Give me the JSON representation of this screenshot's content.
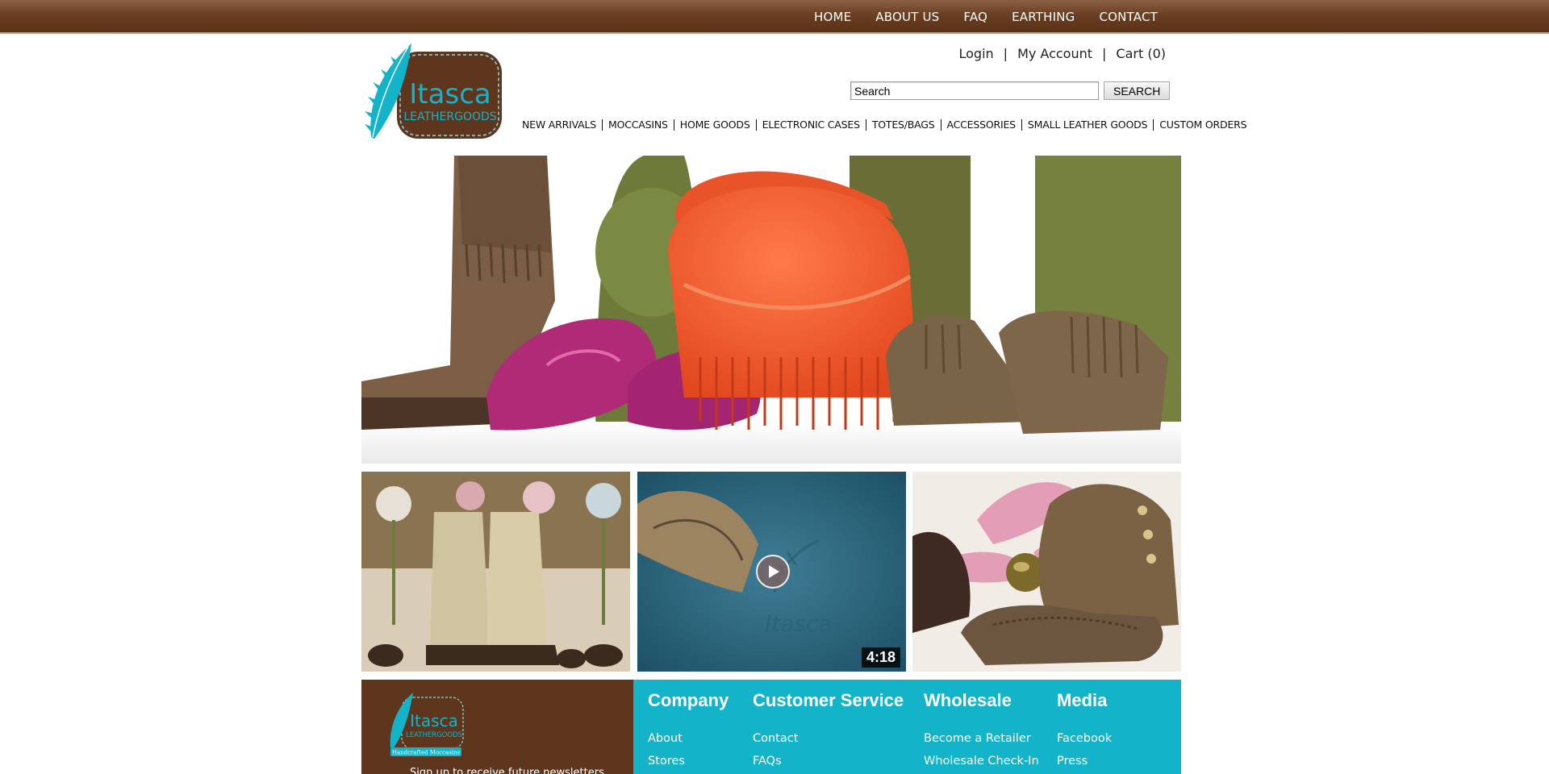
{
  "topnav": [
    {
      "label": "HOME"
    },
    {
      "label": "ABOUT US"
    },
    {
      "label": "FAQ"
    },
    {
      "label": "EARTHING"
    },
    {
      "label": "CONTACT"
    }
  ],
  "brand": {
    "name": "Itasca",
    "sub": "LEATHERGOODS",
    "tag": "Handcrafted Moccasins",
    "colors": {
      "brown": "#5e361d",
      "teal": "#13b3c9"
    }
  },
  "account": {
    "login": "Login",
    "my_account": "My Account",
    "cart": "Cart (0)",
    "separator": "|"
  },
  "search": {
    "value": "Search",
    "button": "SEARCH"
  },
  "categories": [
    {
      "label": "NEW ARRIVALS"
    },
    {
      "label": "MOCCASINS"
    },
    {
      "label": "HOME GOODS"
    },
    {
      "label": "ELECTRONIC CASES"
    },
    {
      "label": "TOTES/BAGS"
    },
    {
      "label": "ACCESSORIES"
    },
    {
      "label": "SMALL LEATHER GOODS"
    },
    {
      "label": "CUSTOM ORDERS"
    }
  ],
  "video": {
    "duration": "4:18",
    "watermark": "Itasca"
  },
  "footer": {
    "newsletter": "Sign up to receive future newsletters",
    "columns": [
      {
        "title": "Company",
        "links": [
          "About",
          "Stores"
        ]
      },
      {
        "title": "Customer Service",
        "links": [
          "Contact",
          "FAQs"
        ]
      },
      {
        "title": "Wholesale",
        "links": [
          "Become a Retailer",
          "Wholesale Check-In"
        ]
      },
      {
        "title": "Media",
        "links": [
          "Facebook",
          "Press"
        ]
      }
    ]
  }
}
